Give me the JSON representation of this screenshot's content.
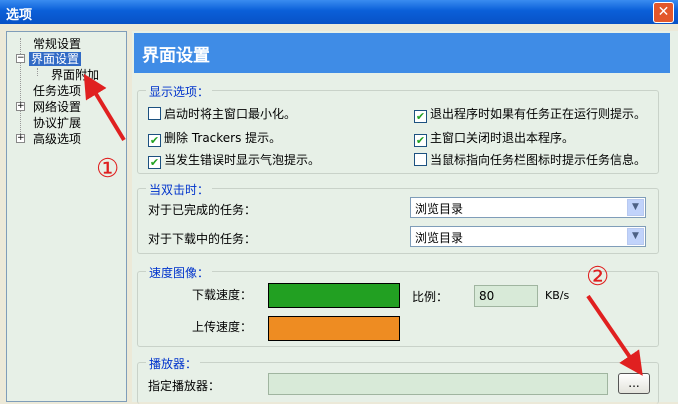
{
  "window": {
    "title": "选项",
    "close_glyph": "✕"
  },
  "tree": {
    "items": [
      {
        "label": "常规设置"
      },
      {
        "label": "界面设置"
      },
      {
        "label": "界面附加"
      },
      {
        "label": "任务选项"
      },
      {
        "label": "网络设置"
      },
      {
        "label": "协议扩展"
      },
      {
        "label": "高级选项"
      }
    ]
  },
  "panel": {
    "header": "界面设置",
    "display": {
      "title": "显示选项：",
      "options": [
        {
          "label": "启动时将主窗口最小化。",
          "checked": false
        },
        {
          "label": "退出程序时如果有任务正在运行则提示。",
          "checked": true
        },
        {
          "label": "删除 Trackers 提示。",
          "checked": true
        },
        {
          "label": "主窗口关闭时退出本程序。",
          "checked": true
        },
        {
          "label": "当发生错误时显示气泡提示。",
          "checked": true
        },
        {
          "label": "当鼠标指向任务栏图标时提示任务信息。",
          "checked": false
        }
      ]
    },
    "doubleclick": {
      "title": "当双击时：",
      "completed_label": "对于已完成的任务：",
      "completed_value": "浏览目录",
      "downloading_label": "对于下载中的任务：",
      "downloading_value": "浏览目录"
    },
    "speed": {
      "title": "速度图像：",
      "download_label": "下载速度：",
      "upload_label": "上传速度：",
      "download_color": "#22a022",
      "upload_color": "#ee8c22",
      "ratio_label": "比例：",
      "ratio_value": "80",
      "ratio_unit": "KB/s"
    },
    "player": {
      "title": "播放器：",
      "specify_label": "指定播放器：",
      "path_value": "",
      "browse_label": "..."
    }
  },
  "annotations": {
    "marker_1": "①",
    "marker_2": "②",
    "color": "#e02020"
  }
}
